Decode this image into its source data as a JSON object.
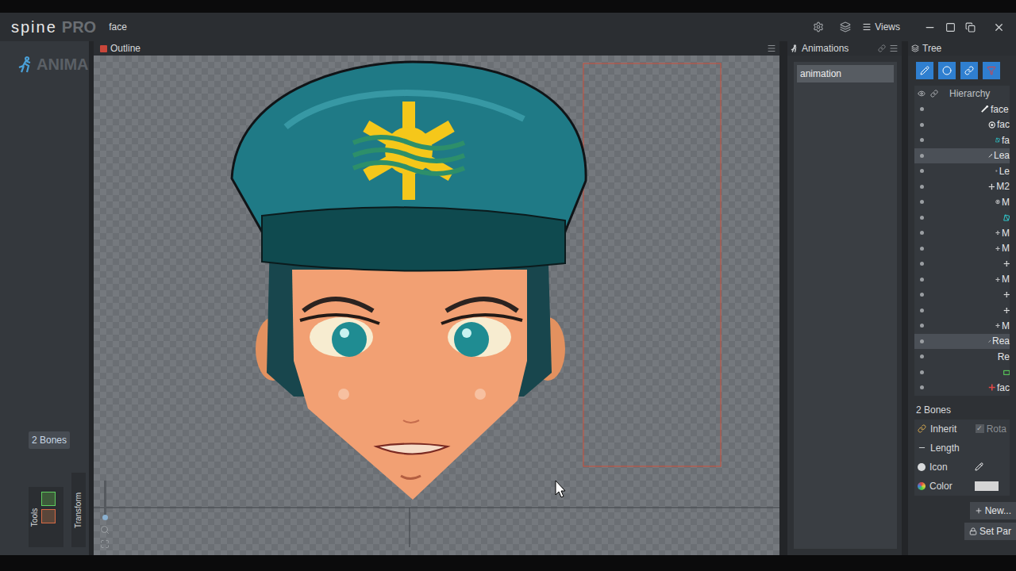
{
  "window": {
    "title": "face",
    "logo": "spine",
    "edition": "PRO",
    "views": "Views"
  },
  "mode": "ANIMA",
  "viewport": {
    "tab": "Outline"
  },
  "left_panel": {
    "selection_badge": "2 Bones",
    "toolbars": [
      "Tools",
      "Transform"
    ]
  },
  "animations": {
    "title": "Animations",
    "items": [
      {
        "name": "animation",
        "selected": true
      }
    ]
  },
  "tree": {
    "title": "Tree",
    "hierarchy_label": "Hierarchy",
    "rows": [
      {
        "label": "face",
        "kind": "bone",
        "depth": 0,
        "selected": false
      },
      {
        "label": "fac",
        "kind": "slot",
        "depth": 1,
        "selected": false
      },
      {
        "label": "fa",
        "kind": "mesh",
        "depth": 2,
        "selected": false
      },
      {
        "label": "Lea",
        "kind": "bone",
        "depth": 1,
        "selected": true
      },
      {
        "label": "Le",
        "kind": "slot",
        "depth": 2,
        "selected": false
      },
      {
        "label": "M2",
        "kind": "node",
        "depth": 1,
        "selected": false
      },
      {
        "label": "M",
        "kind": "slot",
        "depth": 2,
        "selected": false
      },
      {
        "label": "",
        "kind": "mesh",
        "depth": 3,
        "selected": false
      },
      {
        "label": "M",
        "kind": "node",
        "depth": 2,
        "selected": false
      },
      {
        "label": "M",
        "kind": "node",
        "depth": 2,
        "selected": false
      },
      {
        "label": "",
        "kind": "node",
        "depth": 3,
        "selected": false
      },
      {
        "label": "M",
        "kind": "node",
        "depth": 2,
        "selected": false
      },
      {
        "label": "",
        "kind": "node",
        "depth": 3,
        "selected": false
      },
      {
        "label": "",
        "kind": "node",
        "depth": 3,
        "selected": false
      },
      {
        "label": "M",
        "kind": "node",
        "depth": 2,
        "selected": false
      },
      {
        "label": "Rea",
        "kind": "bone",
        "depth": 1,
        "selected": true
      },
      {
        "label": "Re",
        "kind": "slot",
        "depth": 2,
        "selected": false
      },
      {
        "label": "",
        "kind": "region",
        "depth": 3,
        "selected": false
      },
      {
        "label": "fac",
        "kind": "point",
        "depth": 1,
        "selected": false
      }
    ],
    "selection_title": "2 Bones",
    "properties": [
      {
        "label": "Inherit",
        "kind": "checkbox",
        "checked": true,
        "value": "Rota"
      },
      {
        "label": "Length",
        "kind": "text"
      },
      {
        "label": "Icon",
        "kind": "icon"
      },
      {
        "label": "Color",
        "kind": "color",
        "color": "#d4d4d4"
      }
    ],
    "buttons": [
      "New...",
      "Set Par"
    ]
  }
}
